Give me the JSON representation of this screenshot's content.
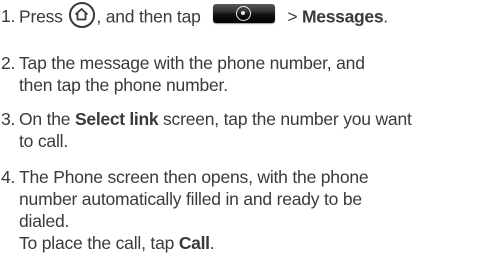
{
  "steps": [
    {
      "number": "1.",
      "parts": {
        "press": "Press",
        "then": ", and then tap",
        "sep": ">",
        "target": "Messages",
        "end": "."
      }
    },
    {
      "number": "2.",
      "lines": [
        "Tap the message with the phone number, and",
        "then tap the phone number."
      ]
    },
    {
      "number": "3.",
      "parts": {
        "pre": "On the",
        "bold": "Select link",
        "post": "screen, tap the number you want",
        "line2": "to call."
      }
    },
    {
      "number": "4.",
      "lines": [
        "The Phone screen then opens, with the phone",
        "number automatically filled in and ready to be",
        "dialed."
      ],
      "last": {
        "pre": "To place the call, tap",
        "bold": "Call",
        "end": "."
      }
    }
  ],
  "icons": {
    "home": "home-key-icon",
    "all_apps": "all-apps-key-icon"
  }
}
